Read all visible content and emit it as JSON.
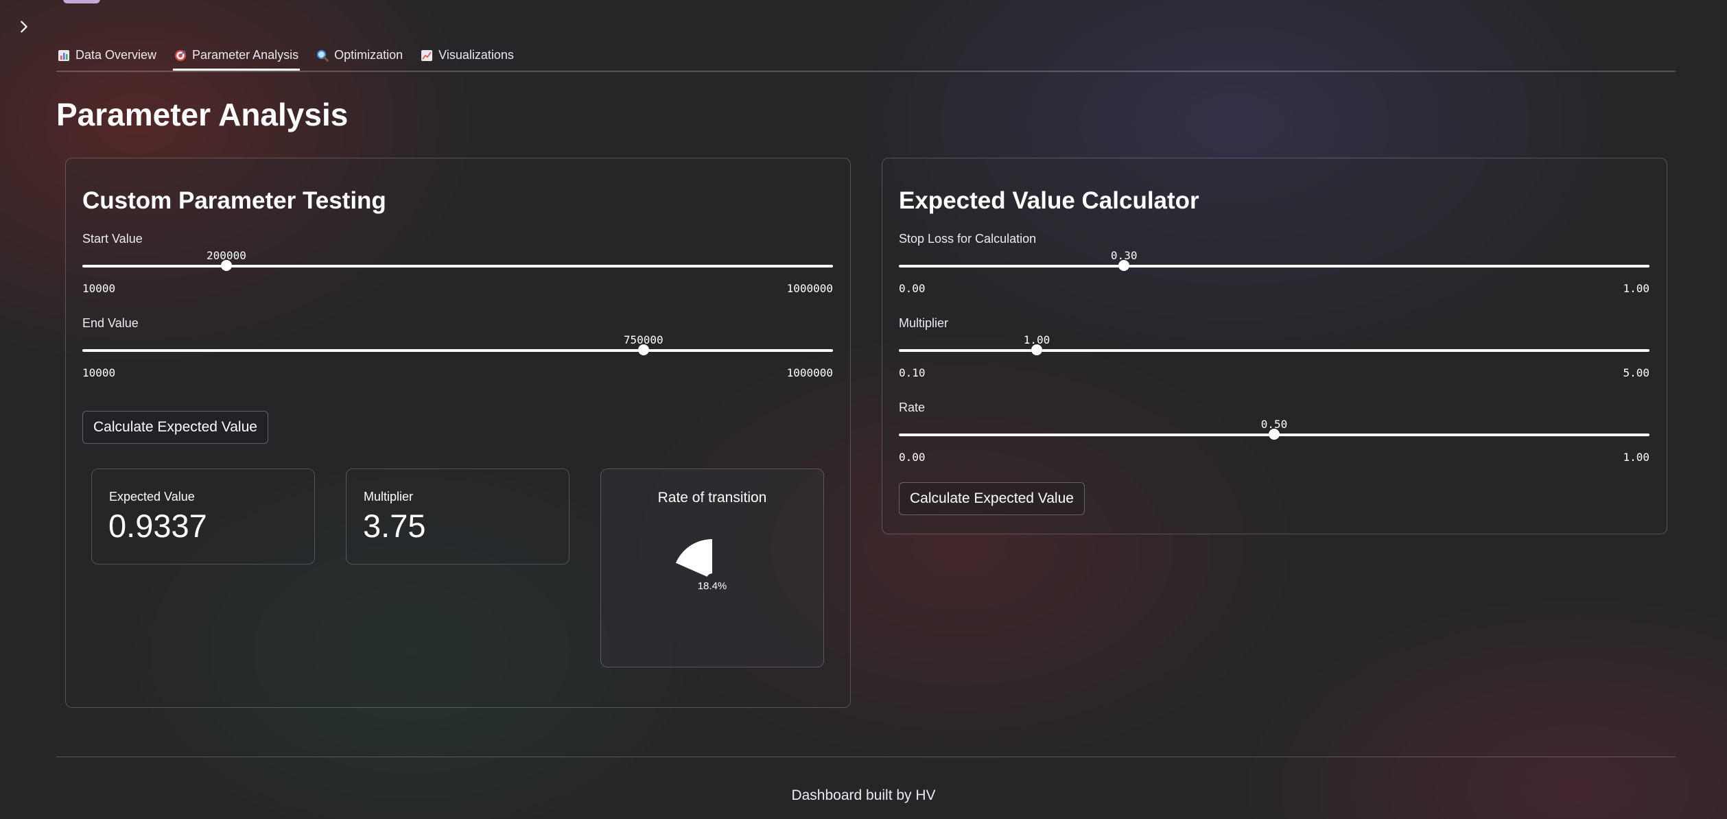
{
  "tabs": [
    {
      "label": "Data Overview",
      "icon": "bar-chart-icon",
      "active": false
    },
    {
      "label": "Parameter Analysis",
      "icon": "target-icon",
      "active": true
    },
    {
      "label": "Optimization",
      "icon": "magnifier-icon",
      "active": false
    },
    {
      "label": "Visualizations",
      "icon": "line-chart-icon",
      "active": false
    }
  ],
  "page": {
    "title": "Parameter Analysis"
  },
  "custom_testing": {
    "title": "Custom Parameter Testing",
    "start_slider": {
      "label": "Start Value",
      "value": "200000",
      "min": "10000",
      "max": "1000000",
      "fraction": 0.1919
    },
    "end_slider": {
      "label": "End Value",
      "value": "750000",
      "min": "10000",
      "max": "1000000",
      "fraction": 0.7475
    },
    "button_label": "Calculate Expected Value",
    "metrics": [
      {
        "label": "Expected Value",
        "value": "0.9337"
      },
      {
        "label": "Multiplier",
        "value": "3.75"
      }
    ],
    "gauge": {
      "title": "Rate of transition",
      "percent_label": "18.4%",
      "fraction": 0.184
    }
  },
  "ev_calculator": {
    "title": "Expected Value Calculator",
    "stop_loss_slider": {
      "label": "Stop Loss for Calculation",
      "value": "0.30",
      "min": "0.00",
      "max": "1.00",
      "fraction": 0.3
    },
    "multiplier_slider": {
      "label": "Multiplier",
      "value": "1.00",
      "min": "0.10",
      "max": "5.00",
      "fraction": 0.1837
    },
    "rate_slider": {
      "label": "Rate",
      "value": "0.50",
      "min": "0.00",
      "max": "1.00",
      "fraction": 0.5
    },
    "button_label": "Calculate Expected Value"
  },
  "footer": {
    "text": "Dashboard built by HV"
  },
  "colors": {
    "accent": "#ffffff",
    "background": "#262628"
  }
}
